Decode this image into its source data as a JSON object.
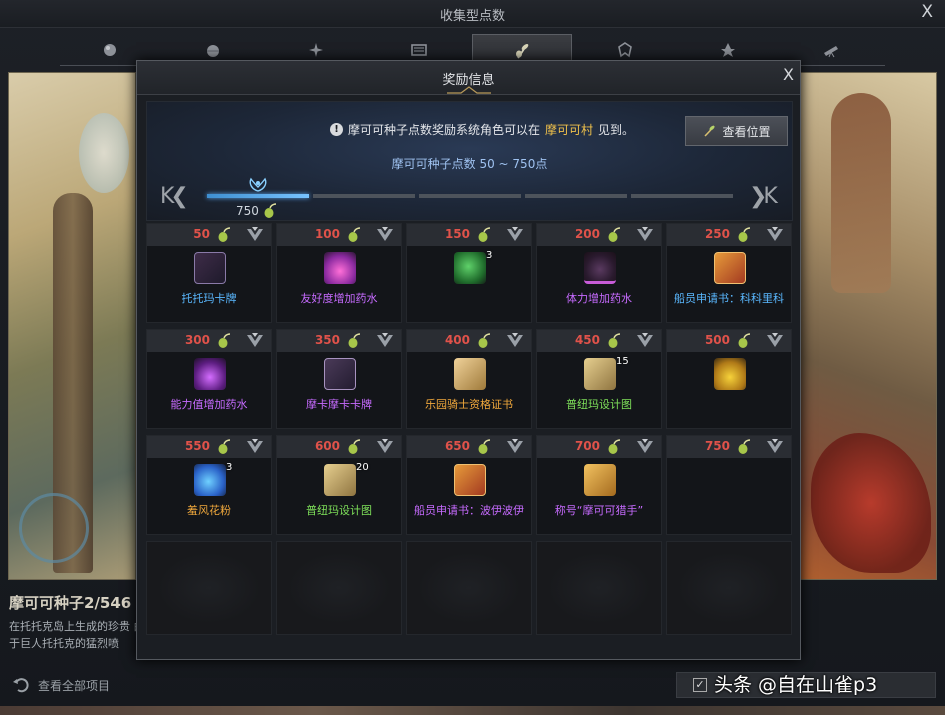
{
  "back_window": {
    "title": "收集型点数",
    "close_label": "X",
    "tabs": [
      {
        "icon": "orb-icon",
        "active": false
      },
      {
        "icon": "sphere-icon",
        "active": false
      },
      {
        "icon": "star-burst-icon",
        "active": false
      },
      {
        "icon": "book-icon",
        "active": false
      },
      {
        "icon": "sprout-icon",
        "active": true
      },
      {
        "icon": "crest-icon",
        "active": false
      },
      {
        "icon": "leaf-icon",
        "active": false
      },
      {
        "icon": "telescope-icon",
        "active": false
      }
    ],
    "item_name": "摩可可种子2/546",
    "description": "在托托克岛上生成的珍贵 由于巨人托托克的猛烈喷",
    "view_all_label": "查看全部项目"
  },
  "dialog": {
    "title": "奖励信息",
    "close_label": "X",
    "notice_prefix": "摩可可种子点数奖励系统角色可以在",
    "notice_highlight": "摩可可村",
    "notice_suffix": "见到。",
    "view_location_label": "查看位置",
    "range_text": "摩可可种子点数 50 ~ 750点",
    "current_points": "750",
    "page_prev_label": "K❮",
    "page_next_label": "❯K",
    "active_segment": 0,
    "segment_count": 5,
    "highlight_color": "#f0c14b",
    "points_color": "#e0524a"
  },
  "rewards": [
    {
      "points": "50",
      "name": "托托玛卡牌",
      "icon": "card-icon",
      "icon_class": "ic-card",
      "name_color": "#5ab8ff",
      "count": ""
    },
    {
      "points": "100",
      "name": "友好度增加药水",
      "icon": "pink-potion-icon",
      "icon_class": "ic-potion-pink",
      "name_color": "#c76bff",
      "count": ""
    },
    {
      "points": "150",
      "name": "",
      "icon": "green-book-icon",
      "icon_class": "ic-book",
      "name_color": "#5ab8ff",
      "count": "3"
    },
    {
      "points": "200",
      "name": "体力增加药水",
      "icon": "dark-potion-icon",
      "icon_class": "ic-potion-dark",
      "name_color": "#c76bff",
      "count": ""
    },
    {
      "points": "250",
      "name": "船员申请书：科科里科",
      "icon": "red-scroll-icon",
      "icon_class": "ic-scroll-red",
      "name_color": "#5ab8ff",
      "count": ""
    },
    {
      "points": "300",
      "name": "能力值增加药水",
      "icon": "purple-potion-icon",
      "icon_class": "ic-potion-purple",
      "name_color": "#c76bff",
      "count": ""
    },
    {
      "points": "350",
      "name": "摩卡摩卡卡牌",
      "icon": "card-icon",
      "icon_class": "ic-card2",
      "name_color": "#c76bff",
      "count": ""
    },
    {
      "points": "400",
      "name": "乐园骑士资格证书",
      "icon": "certificate-icon",
      "icon_class": "ic-cert",
      "name_color": "#f0a83c",
      "count": ""
    },
    {
      "points": "450",
      "name": "普纽玛设计图",
      "icon": "map-icon",
      "icon_class": "ic-map",
      "name_color": "#7ee05a",
      "count": "15"
    },
    {
      "points": "500",
      "name": "",
      "icon": "treasure-chest-icon",
      "icon_class": "ic-chest",
      "name_color": "#5ab8ff",
      "count": ""
    },
    {
      "points": "550",
      "name": "羞风花粉",
      "icon": "powder-icon",
      "icon_class": "ic-powder",
      "name_color": "#f0a83c",
      "count": "3"
    },
    {
      "points": "600",
      "name": "普纽玛设计图",
      "icon": "map-icon",
      "icon_class": "ic-map",
      "name_color": "#7ee05a",
      "count": "20"
    },
    {
      "points": "650",
      "name": "船员申请书：波伊波伊",
      "icon": "red-scroll-icon",
      "icon_class": "ic-scroll-red",
      "name_color": "#c76bff",
      "count": ""
    },
    {
      "points": "700",
      "name": "称号“摩可可猎手”",
      "icon": "title-scroll-icon",
      "icon_class": "ic-title",
      "name_color": "#c76bff",
      "count": ""
    },
    {
      "points": "750",
      "name": "",
      "icon": "empty-slot-icon",
      "icon_class": "",
      "name_color": "#5ab8ff",
      "count": ""
    }
  ],
  "watermark": "头条 @自在山雀p3"
}
